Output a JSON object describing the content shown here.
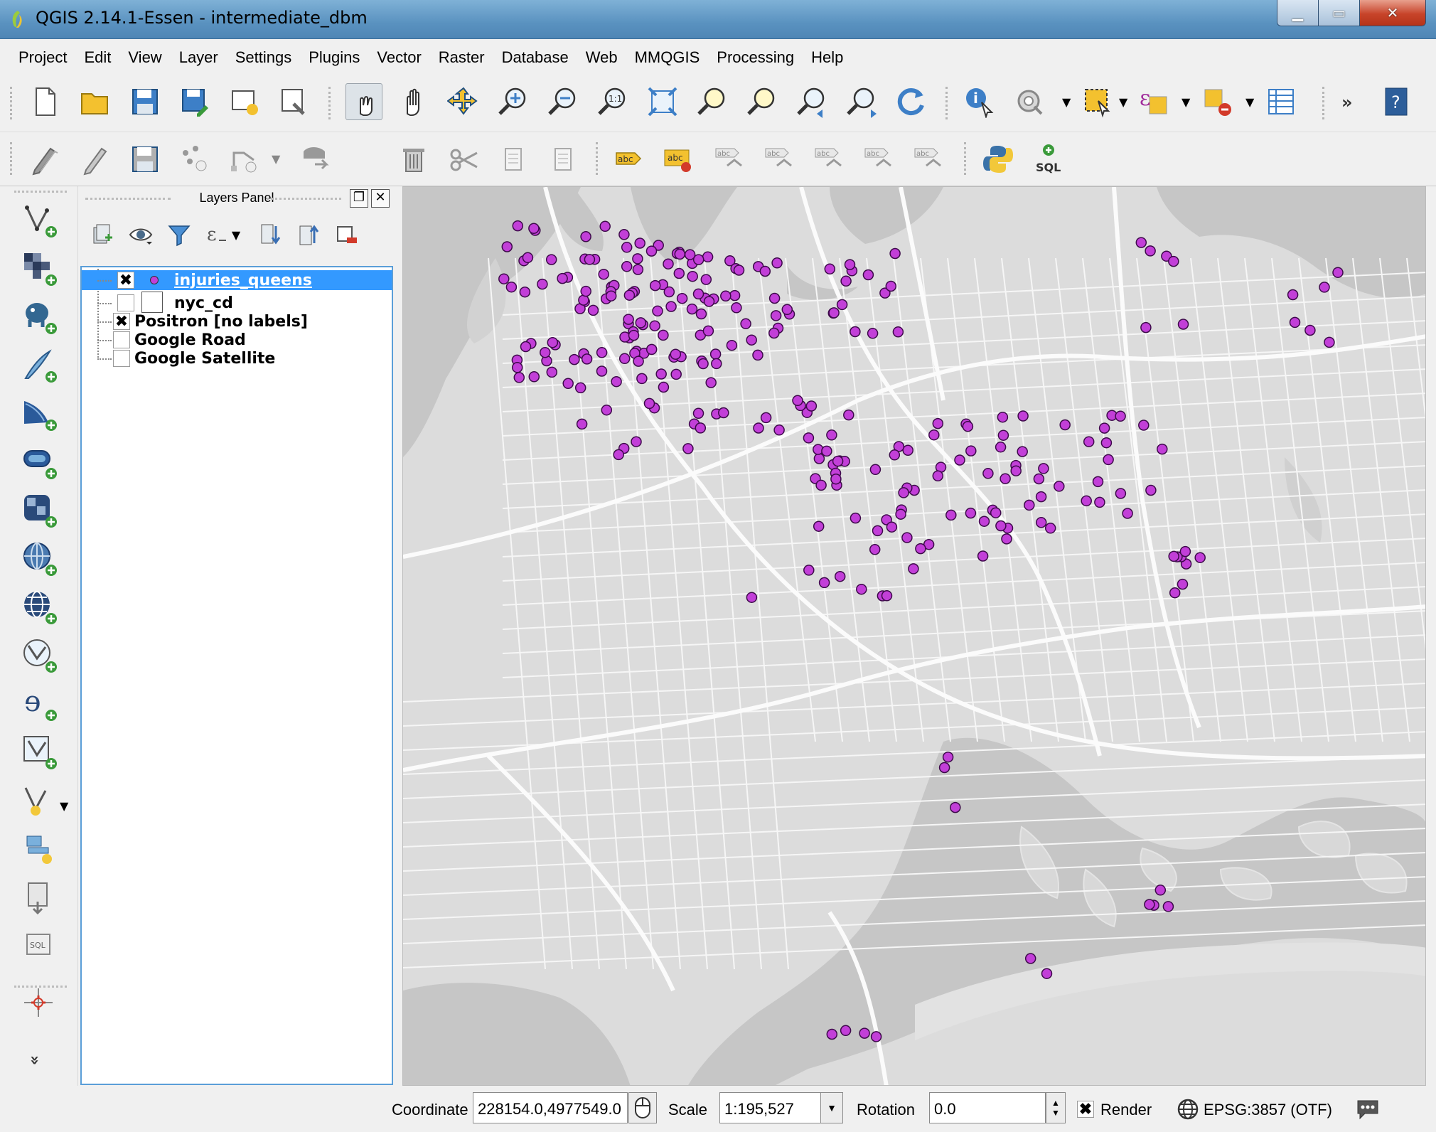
{
  "window": {
    "title": "QGIS 2.14.1-Essen - intermediate_dbm",
    "minimize_icon": "minimize-icon",
    "maximize_icon": "maximize-icon",
    "close_icon": "close-icon"
  },
  "menu": [
    "Project",
    "Edit",
    "View",
    "Layer",
    "Settings",
    "Plugins",
    "Vector",
    "Raster",
    "Database",
    "Web",
    "MMQGIS",
    "Processing",
    "Help"
  ],
  "toolbar_top": [
    "new-project-icon",
    "open-project-icon",
    "save-project-icon",
    "save-as-icon",
    "new-print-composer-icon",
    "composer-manager-icon",
    "touch-zoom-pan-icon",
    "pan-icon",
    "pan-to-selection-icon",
    "zoom-in-icon",
    "zoom-out-icon",
    "zoom-native-icon",
    "zoom-full-icon",
    "zoom-to-selection-icon",
    "zoom-to-layer-icon",
    "zoom-last-icon",
    "zoom-next-icon",
    "refresh-icon",
    "identify-icon",
    "run-action-icon",
    "select-features-icon",
    "expression-select-icon",
    "deselect-icon",
    "attribute-table-icon",
    "more-tools-icon",
    "help-icon"
  ],
  "toolbar_bottom": [
    "current-edits-icon",
    "toggle-editing-icon",
    "save-edits-icon",
    "add-feature-icon",
    "node-tool-icon",
    "move-feature-icon",
    "delete-selected-icon",
    "cut-features-icon",
    "copy-features-icon",
    "paste-features-icon",
    "layer-labeling-icon",
    "pin-labels-icon",
    "show-hide-labels-icon",
    "highlight-pinned-icon",
    "move-label-icon",
    "rotate-label-icon",
    "change-label-icon",
    "python-console-icon",
    "db-manager-sql-icon"
  ],
  "sidebar_tools": [
    "add-vector-layer-icon",
    "add-raster-layer-icon",
    "add-postgis-layer-icon",
    "add-spatialite-layer-icon",
    "add-mssql-layer-icon",
    "add-oracle-layer-icon",
    "add-wms-layer-icon",
    "add-wcs-layer-icon",
    "add-wfs-layer-icon",
    "add-delimited-text-icon",
    "add-virtual-layer-icon",
    "new-shapefile-icon",
    "new-spatialite-icon",
    "new-gpx-icon",
    "load-db-layer-icon",
    "sql-query-icon",
    "coordinate-capture-icon",
    "expand-toolbar-icon"
  ],
  "layers_panel": {
    "title": "Layers Panel",
    "layers": [
      {
        "name": "injuries_queens",
        "checked": true,
        "selected": true
      },
      {
        "name": "nyc_cd",
        "checked": false,
        "selected": false
      },
      {
        "name": "Positron [no labels]",
        "checked": true,
        "selected": false
      },
      {
        "name": "Google Road",
        "checked": false,
        "selected": false
      },
      {
        "name": "Google Satellite",
        "checked": false,
        "selected": false
      }
    ],
    "check_mark": "✖"
  },
  "map": {
    "point_color": "#c23fd8",
    "point_stroke": "#3d0a4a",
    "basemap_land": "#dcdcdc",
    "basemap_water": "#c4c4c4",
    "basemap_road": "#f5f5f5"
  },
  "status": {
    "coordinate_label": "Coordinate",
    "coordinate_value": "228154.0,4977549.0",
    "scale_label": "Scale",
    "scale_value": "1:195,527",
    "rotation_label": "Rotation",
    "rotation_value": "0.0",
    "render_label": "Render",
    "render_checked": "✖",
    "crs_label": "EPSG:3857 (OTF)"
  }
}
